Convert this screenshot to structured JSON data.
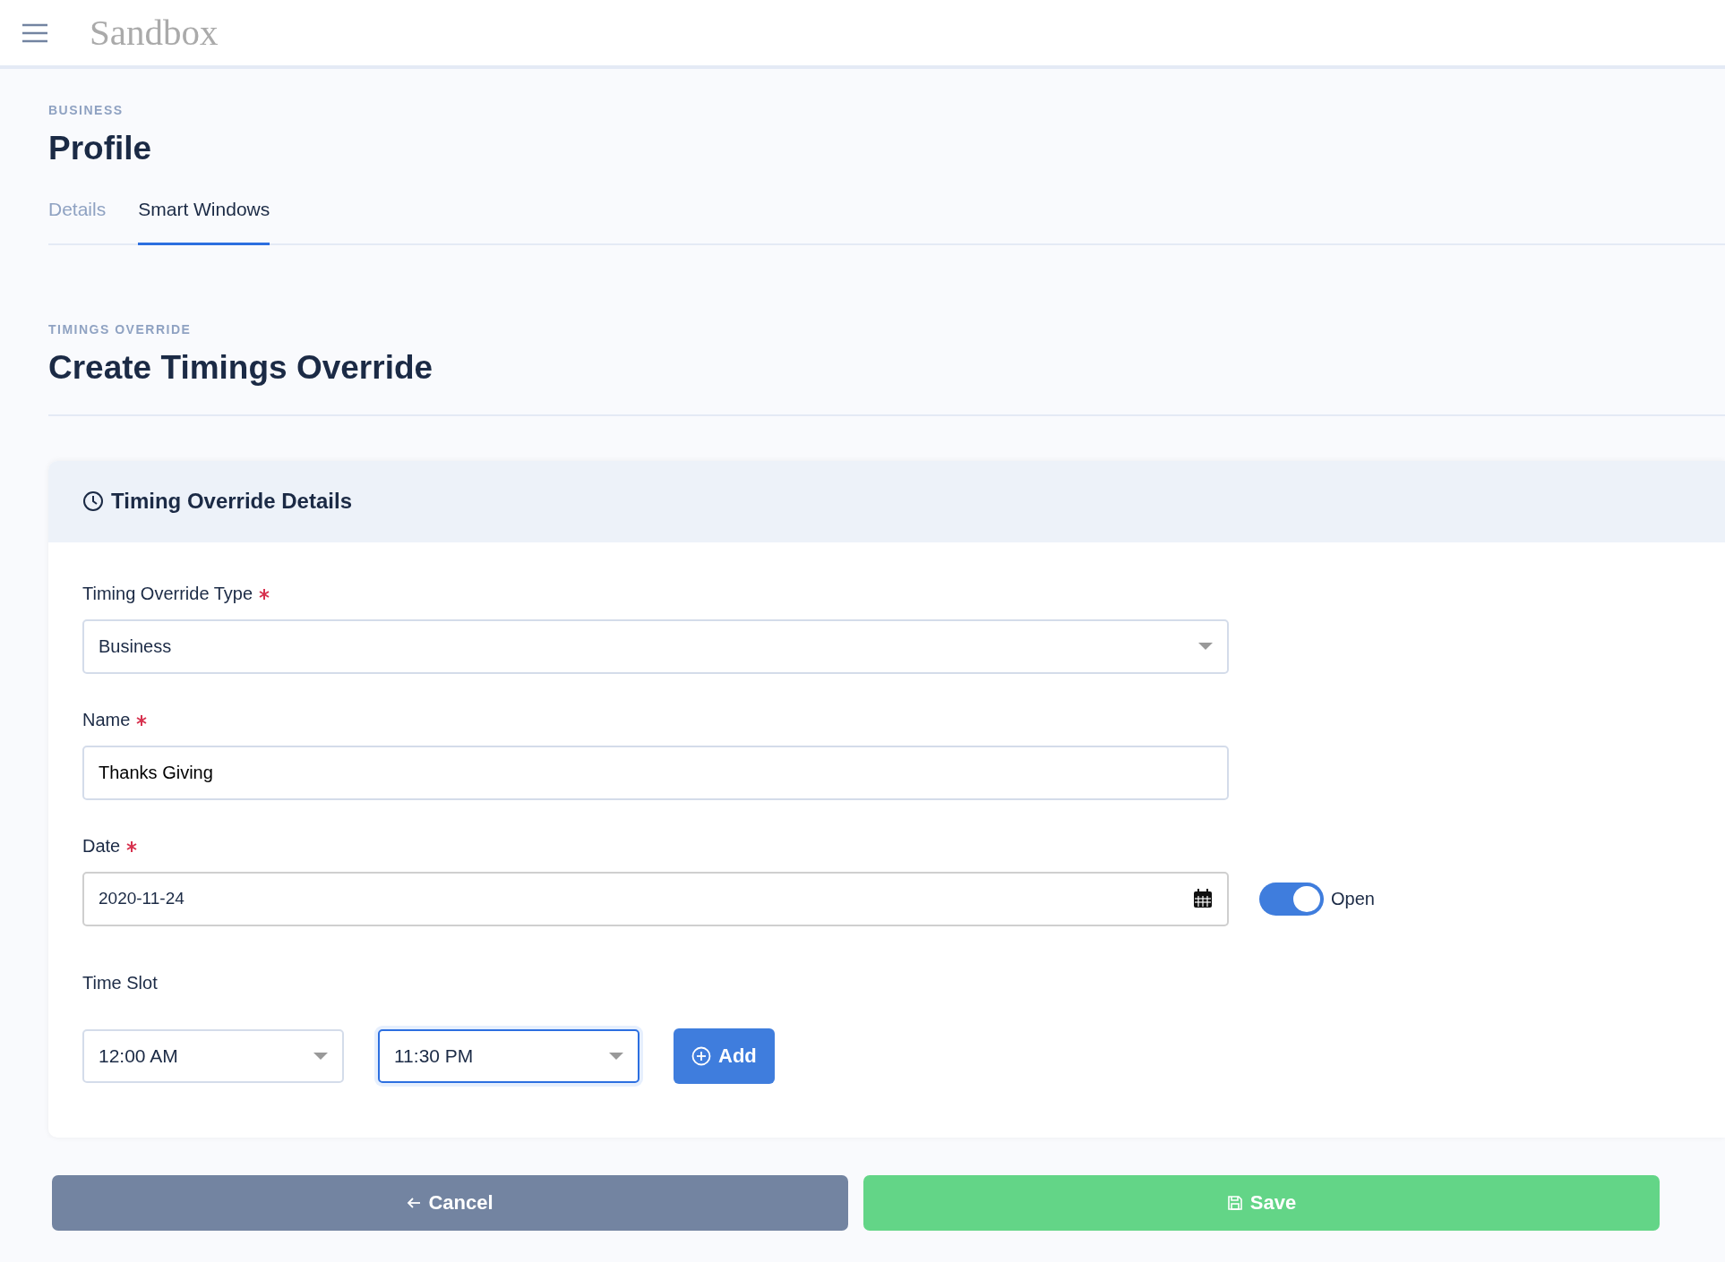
{
  "header": {
    "brand": "Sandbox"
  },
  "page": {
    "eyebrow": "BUSINESS",
    "title": "Profile"
  },
  "tabs": [
    {
      "label": "Details",
      "selected": false
    },
    {
      "label": "Smart Windows",
      "selected": true
    }
  ],
  "section": {
    "eyebrow": "TIMINGS OVERRIDE",
    "title": "Create Timings Override"
  },
  "card": {
    "title": "Timing Override Details",
    "fields": [
      {
        "kind": "select",
        "label": "Timing Override Type",
        "required": true,
        "value": "Business"
      },
      {
        "kind": "text",
        "label": "Name",
        "required": true,
        "value": "Thanks Giving"
      },
      {
        "kind": "date",
        "label": "Date",
        "required": true,
        "value": "2020-11-24",
        "toggle": {
          "label": "Open",
          "on": true
        }
      }
    ],
    "time_slot": {
      "label": "Time Slot",
      "selects": [
        {
          "value": "12:00 AM",
          "focused": false
        },
        {
          "value": "11:30 PM",
          "focused": true
        }
      ],
      "add_button": "Add"
    }
  },
  "buttons": [
    {
      "kind": "cancel",
      "label": "Cancel"
    },
    {
      "kind": "save",
      "label": "Save"
    }
  ]
}
